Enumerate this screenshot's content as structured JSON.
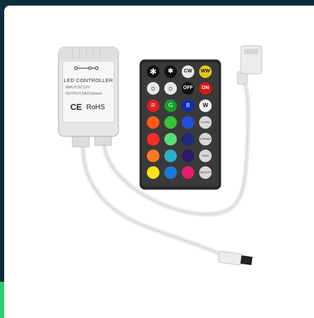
{
  "product": {
    "controller_title": "LED CONTROLLER",
    "input_spec": "INPUT:DC12V",
    "output_spec": "OUTPUT:2A/Channel",
    "cert_ce": "CE",
    "cert_rohs": "RoHS"
  },
  "remote": {
    "buttons_row1": [
      "✱",
      "✱",
      "CW",
      "WW"
    ],
    "buttons_row2": [
      "☼",
      "☼",
      "OFF",
      "ON"
    ],
    "color_labels": [
      "R",
      "G",
      "B",
      "W"
    ],
    "mode_labels": [
      "FLASH",
      "STROBE",
      "FADE",
      "SMOOTH"
    ]
  },
  "colors": {
    "background": "#0b2d3a",
    "accent_strip": "#2ecc71",
    "device_body": "#e6e6e6",
    "remote_body": "#2a2a2a"
  }
}
